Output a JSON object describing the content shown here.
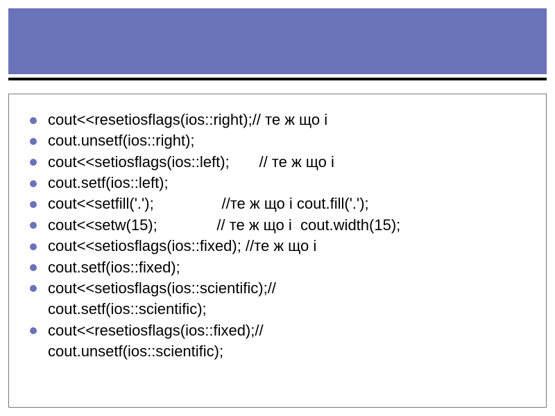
{
  "lines": [
    "cout<<resetiosflags(ios::right);// те ж що і",
    "cout.unsetf(ios::right);",
    "cout<<setiosflags(ios::left);       // те ж що і",
    "cout.setf(ios::left);",
    "cout<<setfill('.');                //те ж що і cout.fill('.');",
    "cout<<setw(15);              // те ж що і  cout.width(15);",
    "cout<<setiosflags(ios::fixed); //те ж що і",
    "cout.setf(ios::fixed);",
    "cout<<setiosflags(ios::scientific);//\ncout.setf(ios::scientific);",
    "cout<<resetiosflags(ios::fixed);//\ncout.unsetf(ios::scientific);"
  ]
}
